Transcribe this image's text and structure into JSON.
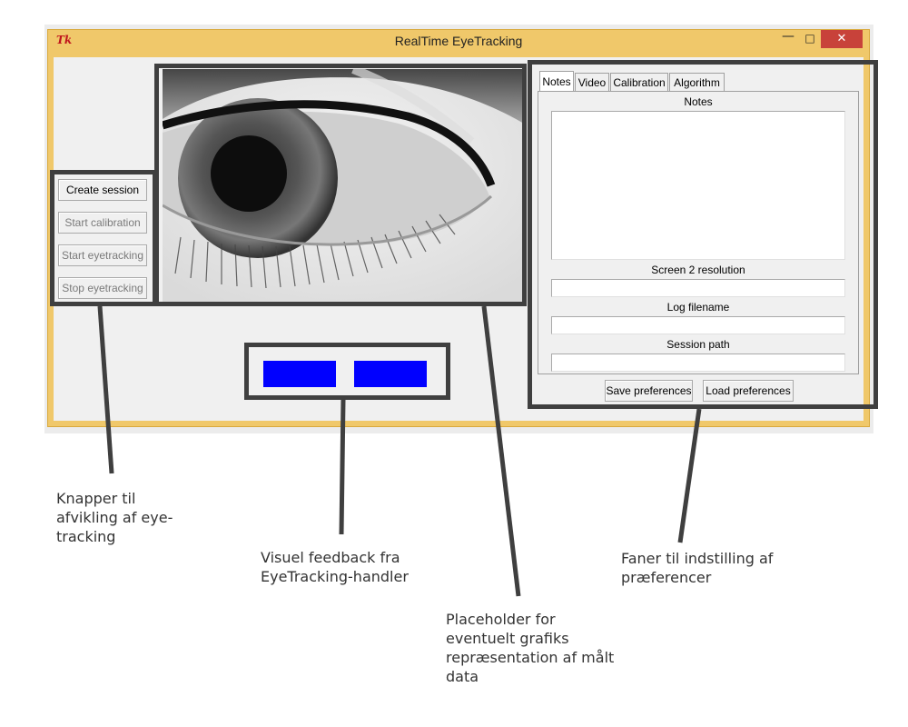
{
  "window": {
    "title": "RealTime EyeTracking",
    "app_logo": "Tk",
    "controls": {
      "minimize": "—",
      "maximize": "□",
      "close": "✕"
    }
  },
  "buttons": {
    "create_session": "Create session",
    "start_calibration": "Start calibration",
    "start_eyetracking": "Start eyetracking",
    "stop_eyetracking": "Stop eyetracking"
  },
  "tabs": [
    {
      "label": "Notes",
      "active": true
    },
    {
      "label": "Video",
      "active": false
    },
    {
      "label": "Calibration",
      "active": false
    },
    {
      "label": "Algorithm",
      "active": false
    }
  ],
  "notes_panel": {
    "notes_label": "Notes",
    "notes_value": "",
    "screen2_label": "Screen 2 resolution",
    "screen2_value": "",
    "log_label": "Log filename",
    "log_value": "",
    "session_label": "Session path",
    "session_value": ""
  },
  "prefs": {
    "save": "Save preferences",
    "load": "Load preferences"
  },
  "feedback": {
    "color": "#0000ff"
  },
  "annotations": {
    "buttons": "Knapper til\nafvikling af eye-\ntracking",
    "feedback": "Visuel feedback fra\nEyeTracking-handler",
    "placeholder": "Placeholder for\neventuelt grafiks\nrepræsentation af målt\ndata",
    "tabs": "Faner til indstilling af\npræferencer"
  },
  "colors": {
    "titlebar": "#f0c86a",
    "close_button": "#c8423a",
    "annotation_frame": "#3f3f3f"
  }
}
